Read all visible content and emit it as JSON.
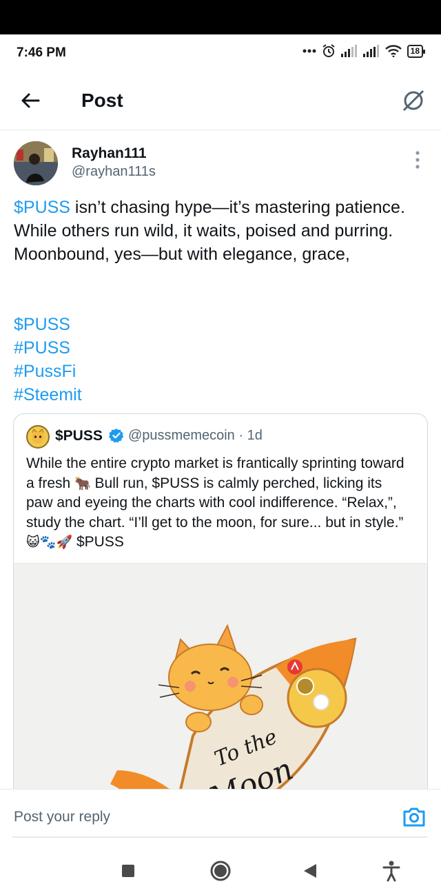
{
  "status_bar": {
    "time": "7:46 PM",
    "battery": "18"
  },
  "header": {
    "title": "Post"
  },
  "post": {
    "author_name": "Rayhan111",
    "author_handle": "@rayhan111s",
    "cashtag": "$PUSS",
    "text": " isn’t chasing hype—it’s mastering patience. While others run wild, it waits, poised and purring. Moonbound, yes—but with elegance, grace,",
    "hashtags": [
      "$PUSS",
      "#PUSS",
      "#PussFi",
      "#Steemit"
    ]
  },
  "quoted_post": {
    "name": "$PUSS",
    "handle": "@pussmemecoin · 1d",
    "text_part1": "While the entire crypto market is frantically sprinting toward a fresh ",
    "text_part2": " Bull run, $PUSS is calmly perched, licking its paw and eyeing the charts with cool indifference. “Relax,”, study the chart. “I’ll get to the moon, for sure... but in style.” ",
    "emoji_bull": "🐂",
    "emoji_tail": "😺🐾🚀",
    "text_end": " $PUSS",
    "image": {
      "rocket_text_line1": "To the",
      "rocket_text_line2": "Moon"
    }
  },
  "reply": {
    "placeholder": "Post your reply"
  },
  "icons": {
    "back": "arrow-left-icon",
    "grok": "grok-icon",
    "more": "more-vertical-icon",
    "verified": "verified-badge-icon",
    "camera": "camera-icon",
    "nav": [
      "square-icon",
      "home-circle-icon",
      "back-triangle-icon",
      "accessibility-icon"
    ]
  },
  "colors": {
    "link": "#1d9bf0",
    "text": "#0f1419",
    "secondary": "#536471"
  }
}
